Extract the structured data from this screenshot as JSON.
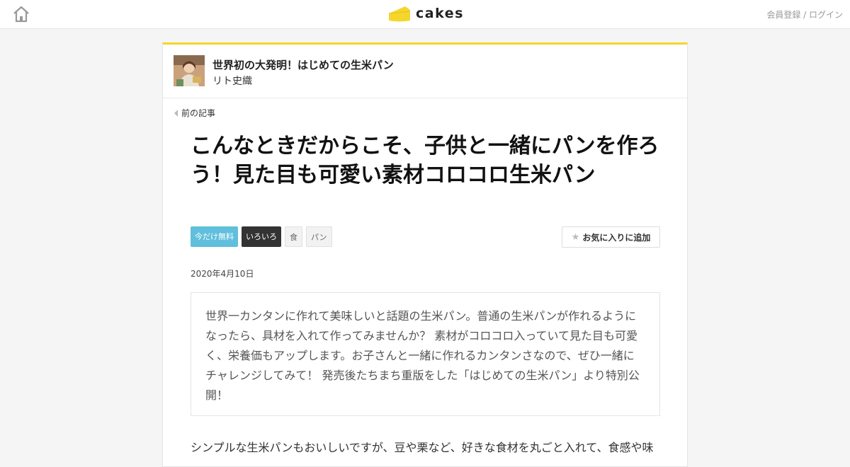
{
  "header": {
    "home_icon": "home-icon",
    "logo_text": "cakes",
    "brand_color": "#f5d62c",
    "auth_link": "会員登録 / ログイン"
  },
  "series": {
    "title": "世界初の大発明！はじめての生米パン",
    "author": "リト史織"
  },
  "nav": {
    "prev_label": "前の記事"
  },
  "article": {
    "title": "こんなときだからこそ、子供と一緒にパンを作ろう！見た目も可愛い素材コロコロ生米パン",
    "tags": [
      {
        "label": "今だけ無料",
        "style": "free"
      },
      {
        "label": "いろいろ",
        "style": "dark"
      },
      {
        "label": "食",
        "style": "plain"
      },
      {
        "label": "パン",
        "style": "plain"
      }
    ],
    "favorite_label": "お気に入りに追加",
    "date": "2020年4月10日",
    "lead": "世界一カンタンに作れて美味しいと話題の生米パン。普通の生米パンが作れるようになったら、具材を入れて作ってみませんか？ 素材がコロコロ入っていて見た目も可愛く、栄養価もアップします。お子さんと一緒に作れるカンタンさなので、ぜひ一緒にチャレンジしてみて！ 発売後たちまち重版をした「はじめての生米パン」より特別公開！",
    "body_start": "シンプルな生米パンもおいしいですが、豆や栗など、好きな食材を丸ごと入れて、食感や味"
  }
}
